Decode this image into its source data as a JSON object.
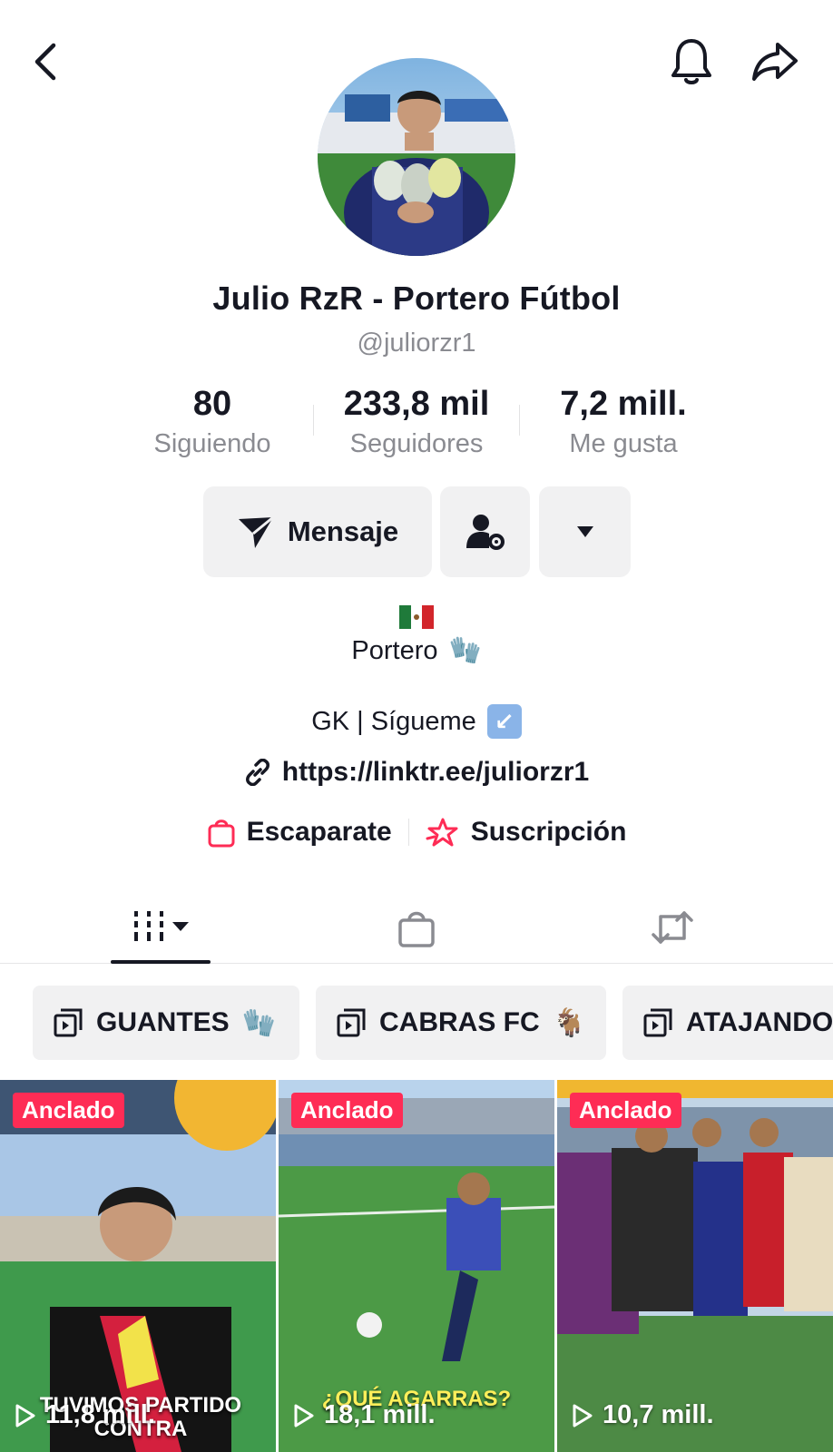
{
  "profile": {
    "display_name": "Julio RzR - Portero Fútbol",
    "username": "@juliorzr1"
  },
  "stats": [
    {
      "value": "80",
      "label": "Siguiendo"
    },
    {
      "value": "233,8 mil",
      "label": "Seguidores"
    },
    {
      "value": "7,2 mill.",
      "label": "Me gusta"
    }
  ],
  "actions": {
    "message_label": "Mensaje"
  },
  "bio": {
    "flag_icon": "mexico-flag-icon",
    "line1": "Portero",
    "line1_emoji": "🧤",
    "line2": "GK | Sígueme",
    "line2_emoji": "↙",
    "link": "https://linktr.ee/juliorzr1"
  },
  "shop": {
    "storefront": "Escaparate",
    "subscription": "Suscripción"
  },
  "playlists": [
    {
      "label": "GUANTES",
      "emoji": "🧤"
    },
    {
      "label": "CABRAS FC",
      "emoji": "🐐"
    },
    {
      "label": "ATAJANDO",
      "emoji": ""
    }
  ],
  "videos": [
    {
      "badge": "Anclado",
      "views": "11,8 mill.",
      "caption": "TUVIMOS PARTIDO CONTRA"
    },
    {
      "badge": "Anclado",
      "views": "18,1 mill.",
      "caption": "¿QUÉ AGARRAS?"
    },
    {
      "badge": "Anclado",
      "views": "10,7 mill.",
      "caption": ""
    }
  ],
  "colors": {
    "accent": "#fe2c55",
    "text": "#161823",
    "secondary_text": "#8a8b91",
    "button_bg": "#f1f1f2"
  }
}
